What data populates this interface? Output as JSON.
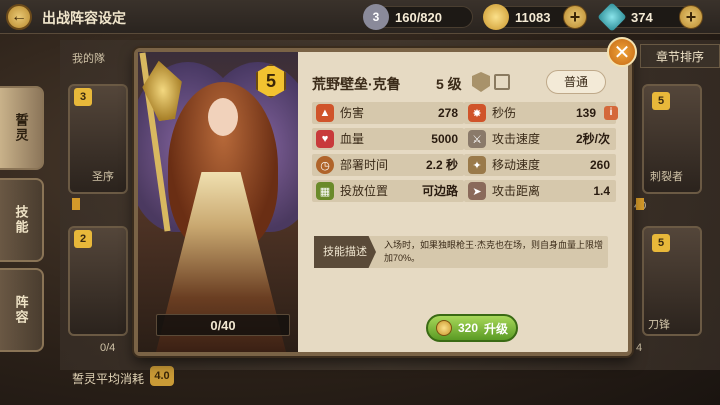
{
  "header": {
    "title": "出战阵容设定",
    "resources": [
      {
        "icon": "shield-badge-icon",
        "badge": "3",
        "value": "160/820",
        "color": "#8a8a9a"
      },
      {
        "icon": "gold-coin-icon",
        "value": "11083",
        "color": "#d4a432"
      },
      {
        "icon": "blue-gem-icon",
        "value": "374",
        "color": "#3ab0b8"
      }
    ]
  },
  "side_tabs": [
    "誓灵",
    "技能",
    "阵容"
  ],
  "sort_label": "章节排序",
  "avg_cost": {
    "label": "誓灵平均消耗",
    "value": "4.0"
  },
  "background_cards": [
    {
      "label": "我的隊",
      "badge": "3"
    },
    {
      "label": "圣序",
      "badge": ""
    },
    {
      "label": "0/4",
      "badge": "2"
    },
    {
      "label": "刺裂者",
      "badge": "5"
    },
    {
      "label": "40",
      "badge": ""
    },
    {
      "label": "刀锋",
      "badge": "5"
    },
    {
      "label": "4",
      "badge": ""
    }
  ],
  "hero": {
    "star": "5",
    "name": "荒野壁垒·克鲁",
    "level": "5 级",
    "rarity": "普通",
    "fragment_progress": "0/40",
    "fragment_fraction": 0,
    "stats_left": [
      {
        "icon": "fire-icon",
        "label": "伤害",
        "value": "278",
        "color": "#d0542a"
      },
      {
        "icon": "heart-icon",
        "label": "血量",
        "value": "5000",
        "color": "#c83a3a"
      },
      {
        "icon": "clock-icon",
        "label": "部署时间",
        "value": "2.2 秒",
        "color": "#b0642a"
      },
      {
        "icon": "grid-icon",
        "label": "投放位置",
        "value": "可边路",
        "color": "#6a8a2a"
      }
    ],
    "stats_right": [
      {
        "icon": "burst-icon",
        "label": "秒伤",
        "value": "139",
        "color": "#d0542a"
      },
      {
        "icon": "sword-icon",
        "label": "攻击速度",
        "value": "2秒/次",
        "color": "#8a7a6a"
      },
      {
        "icon": "wing-icon",
        "label": "移动速度",
        "value": "260",
        "color": "#9a7a4a"
      },
      {
        "icon": "arrow-icon",
        "label": "攻击距离",
        "value": "1.4",
        "color": "#8a6a5a"
      }
    ],
    "skill": {
      "tag": "技能描述",
      "description": "入场时，如果独眼枪王·杰克也在场，则自身血量上限增加70%。"
    },
    "upgrade": {
      "cost": "320",
      "label": "升级"
    }
  }
}
